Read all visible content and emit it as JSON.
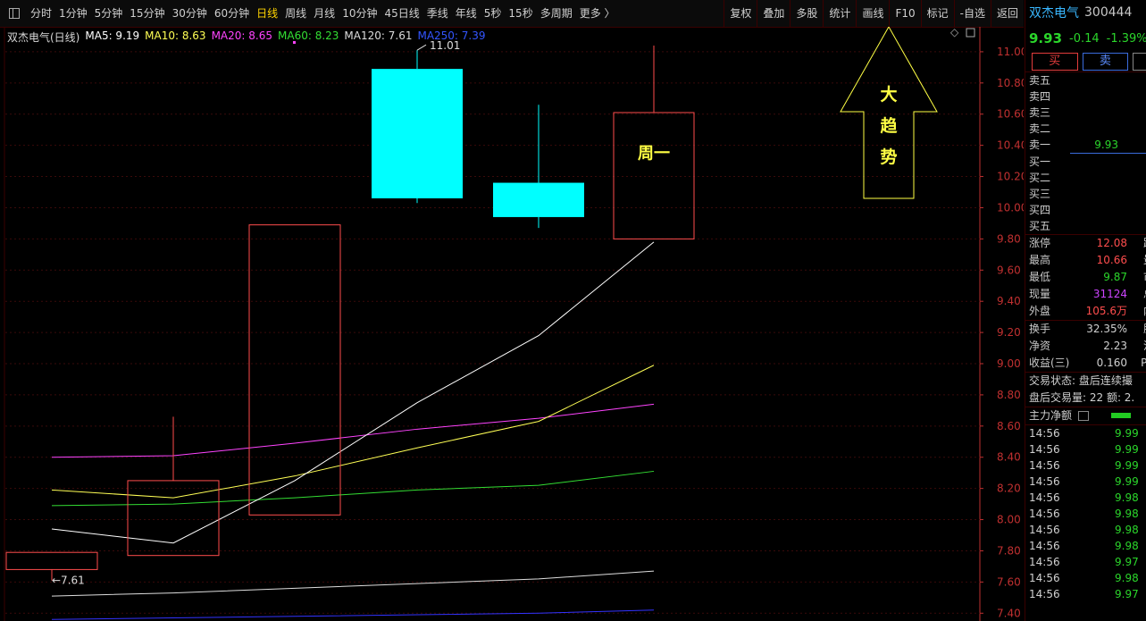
{
  "toolbar": {
    "periods": [
      "分时",
      "1分钟",
      "5分钟",
      "15分钟",
      "30分钟",
      "60分钟",
      "日线",
      "周线",
      "月线",
      "10分钟",
      "45日线",
      "季线",
      "年线",
      "5秒",
      "15秒",
      "多周期",
      "更多 〉"
    ],
    "active": "日线",
    "right_buttons": [
      "复权",
      "叠加",
      "多股",
      "统计",
      "画线",
      "F10",
      "标记",
      "-自选",
      "返回"
    ]
  },
  "legend": {
    "name": "双杰电气(日线)",
    "ma5": "MA5: 9.19",
    "ma10": "MA10: 8.63",
    "ma20": "MA20: 8.65",
    "ma60": "MA60: 8.23",
    "ma120": "MA120: 7.61",
    "ma250": "MA250: 7.39"
  },
  "colors": {
    "ma5": "#ffffff",
    "ma10": "#ffff55",
    "ma20": "#ff44ff",
    "ma60": "#33dd33",
    "ma120": "#dddddd",
    "ma250": "#3333ff",
    "up": "#ff4d4d",
    "down": "#00ffff",
    "axis": "#c03030",
    "annot": "#ffff44"
  },
  "annotations": {
    "weekday": "周一",
    "arrow_chars": [
      "大",
      "趋",
      "势"
    ],
    "high_label": "11.01",
    "low_label": "←7.61"
  },
  "chart_data": {
    "type": "candlestick",
    "ylim": [
      7.35,
      11.16
    ],
    "yticks": [
      "11.00",
      "10.80",
      "10.60",
      "10.40",
      "10.20",
      "10.00",
      "9.80",
      "9.60",
      "9.40",
      "9.20",
      "9.00",
      "8.80",
      "8.60",
      "8.40",
      "8.20",
      "8.00",
      "7.80",
      "7.60",
      "7.40"
    ],
    "candles": [
      {
        "open": 7.79,
        "close": 7.68,
        "high": 7.79,
        "low": 7.61,
        "dir": "up"
      },
      {
        "open": 7.77,
        "close": 8.25,
        "high": 8.66,
        "low": 7.77,
        "dir": "up"
      },
      {
        "open": 8.03,
        "close": 9.89,
        "high": 9.89,
        "low": 8.03,
        "dir": "up"
      },
      {
        "open": 10.89,
        "close": 10.06,
        "high": 11.01,
        "low": 10.03,
        "dir": "down"
      },
      {
        "open": 10.16,
        "close": 9.94,
        "high": 10.66,
        "low": 9.87,
        "dir": "down"
      },
      {
        "open": 9.8,
        "close": 10.61,
        "high": 11.04,
        "low": 9.8,
        "dir": "up"
      }
    ],
    "ma_lines": {
      "ma5": [
        7.94,
        7.85,
        8.25,
        8.75,
        9.18,
        9.78
      ],
      "ma10": [
        8.19,
        8.14,
        8.28,
        8.46,
        8.63,
        8.99
      ],
      "ma20": [
        8.4,
        8.41,
        8.49,
        8.58,
        8.65,
        8.74
      ],
      "ma60": [
        8.09,
        8.1,
        8.14,
        8.19,
        8.22,
        8.31
      ],
      "ma120": [
        7.51,
        7.53,
        7.56,
        7.59,
        7.62,
        7.67
      ],
      "ma250": [
        7.36,
        7.37,
        7.38,
        7.39,
        7.4,
        7.42
      ]
    }
  },
  "quote": {
    "name": "双杰电气",
    "code": "300444",
    "price": "9.93",
    "change": "-0.14",
    "pct": "-1.39%",
    "buy_label": "买",
    "sell_label": "卖",
    "sell_levels": [
      "卖五",
      "卖四",
      "卖三",
      "卖二",
      "卖一"
    ],
    "sell1_price": "9.93",
    "buy_levels": [
      "买一",
      "买二",
      "买三",
      "买四",
      "买五"
    ],
    "stats1": [
      {
        "k": "涨停",
        "v": "12.08",
        "c": "#ff4d4d",
        "k2": "跌"
      },
      {
        "k": "最高",
        "v": "10.66",
        "c": "#ff4d4d",
        "k2": "量"
      },
      {
        "k": "最低",
        "v": "9.87",
        "c": "#2bd62b",
        "k2": "市"
      },
      {
        "k": "现量",
        "v": "31124",
        "c": "#cc44ff",
        "k2": "总"
      },
      {
        "k": "外盘",
        "v": "105.6万",
        "c": "#ff4d4d",
        "k2": "内"
      }
    ],
    "stats2": [
      {
        "k": "换手",
        "v": "32.35%",
        "c": "#d0d0d0",
        "k2": "股"
      },
      {
        "k": "净资",
        "v": "2.23",
        "c": "#d0d0d0",
        "k2": "流"
      },
      {
        "k": "收益(三)",
        "v": "0.160",
        "c": "#d0d0d0",
        "k2": "PE"
      }
    ],
    "trade_status": "交易状态: 盘后连续撮",
    "after_hours": "盘后交易量: 22  额: 2.",
    "main_flow": "主力净额",
    "ticks": [
      {
        "t": "14:56",
        "p": "9.99"
      },
      {
        "t": "14:56",
        "p": "9.99"
      },
      {
        "t": "14:56",
        "p": "9.99"
      },
      {
        "t": "14:56",
        "p": "9.99"
      },
      {
        "t": "14:56",
        "p": "9.98"
      },
      {
        "t": "14:56",
        "p": "9.98"
      },
      {
        "t": "14:56",
        "p": "9.98"
      },
      {
        "t": "14:56",
        "p": "9.98"
      },
      {
        "t": "14:56",
        "p": "9.97"
      },
      {
        "t": "14:56",
        "p": "9.98"
      },
      {
        "t": "14:56",
        "p": "9.97"
      }
    ]
  }
}
